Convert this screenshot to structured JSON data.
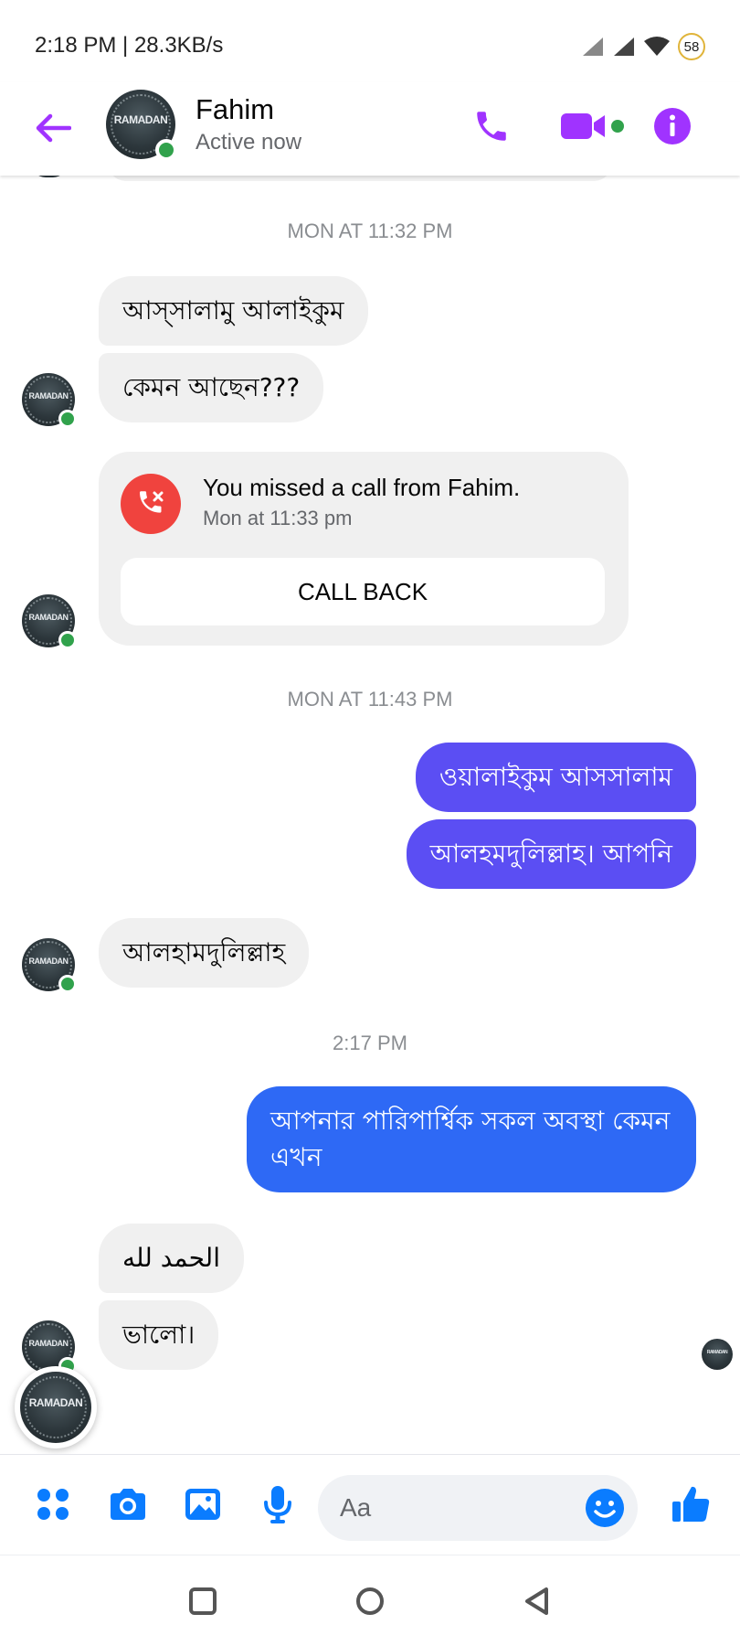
{
  "status_bar": {
    "time": "2:18 PM | 28.3KB/s",
    "battery": "58"
  },
  "header": {
    "contact_name": "Fahim",
    "contact_status": "Active now",
    "avatar_text": "RAMADAN"
  },
  "colors": {
    "accent": "#a033ff",
    "outgoing_bubble_1": "#5b4ef3",
    "outgoing_bubble_2": "#2e69f5",
    "incoming_bubble": "#f0f0f0",
    "online": "#31a24c",
    "missed_call": "#f0433e",
    "composer_icon": "#0a7cff"
  },
  "thread": {
    "stamp_1": "MON AT 11:32 PM",
    "msg_1": "আস্সালামু আলাইকুম",
    "msg_2": "কেমন আছেন???",
    "missed_call": {
      "title": "You missed a call from Fahim.",
      "time": "Mon at 11:33 pm",
      "action": "CALL BACK"
    },
    "stamp_2": "MON AT 11:43 PM",
    "msg_3": "ওয়ালাইকুম আসসালাম",
    "msg_4": "আলহমদুলিল্লাহ। আপনি",
    "msg_5": "আলহামদুলিল্লাহ",
    "stamp_3": "2:17 PM",
    "msg_6": "আপনার পারিপার্শ্বিক সকল অবস্থা কেমন এখন",
    "msg_7": "الحمد لله",
    "msg_8": "ভালো।"
  },
  "composer": {
    "placeholder": "Aa"
  },
  "icons": {
    "back": "back-arrow-icon",
    "call": "phone-icon",
    "video": "video-camera-icon",
    "info": "info-icon",
    "menu": "four-dots-icon",
    "camera": "camera-icon",
    "gallery": "image-icon",
    "mic": "microphone-icon",
    "emoji": "emoji-icon",
    "like": "thumbs-up-icon"
  }
}
